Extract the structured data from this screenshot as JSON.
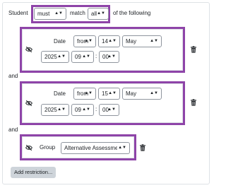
{
  "header": {
    "student_label": "Student",
    "must_select": "must",
    "match_label": "match",
    "all_select": "all",
    "of_the_following": "of the following"
  },
  "connector_and": "and",
  "restrictions": [
    {
      "type_label": "Date",
      "direction": "from",
      "day": "14",
      "month": "May",
      "year": "2025",
      "hour": "09",
      "minute": "00",
      "time_separator": ":"
    },
    {
      "type_label": "Date",
      "direction": "from",
      "day": "15",
      "month": "May",
      "year": "2025",
      "hour": "09",
      "minute": "00",
      "time_separator": ":"
    },
    {
      "type_label": "Group",
      "group": "Alternative Assessment"
    }
  ],
  "add_restriction_label": "Add restriction...",
  "icons": {
    "eye": "eye-slash-icon",
    "delete": "trash-icon",
    "caret": "caret-updown-icon"
  },
  "colors": {
    "highlight": "#8e44a8",
    "button_bg": "#ced4da",
    "border": "#dee2e6"
  }
}
